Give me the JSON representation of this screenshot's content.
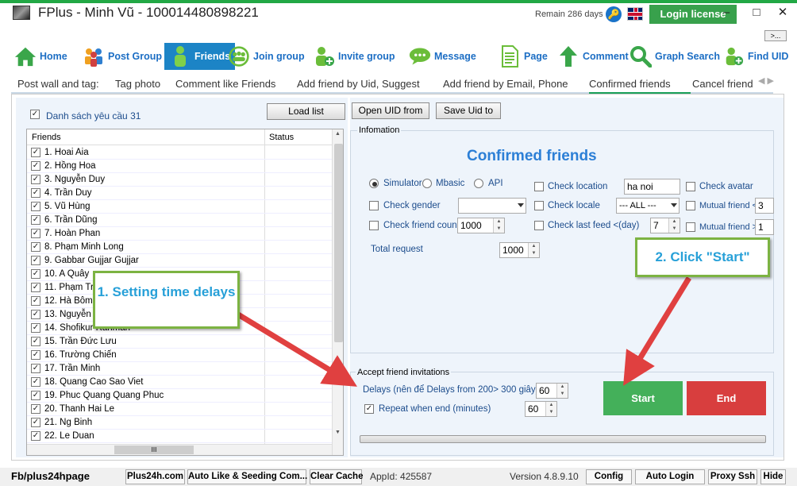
{
  "window": {
    "title": "FPlus - Minh Vũ - 100014480898221",
    "remain": "Remain 286 days",
    "login_license": "Login license",
    "minimize": "–",
    "maximize": "□",
    "close": "✕",
    "more": ">..."
  },
  "nav": [
    {
      "label": "Home",
      "icon": "home-icon"
    },
    {
      "label": "Post Group",
      "icon": "group-icon"
    },
    {
      "label": "Friends",
      "icon": "person-icon",
      "active": true
    },
    {
      "label": "Join group",
      "icon": "people-circle-icon"
    },
    {
      "label": "Invite group",
      "icon": "person-add-icon"
    },
    {
      "label": "Message",
      "icon": "chat-icon"
    },
    {
      "label": "Page",
      "icon": "document-icon"
    },
    {
      "label": "Comment",
      "icon": "arrow-up-icon"
    },
    {
      "label": "Graph Search",
      "icon": "magnifier-icon"
    },
    {
      "label": "Find UID",
      "icon": "person-add-icon"
    }
  ],
  "tabs": [
    "Post wall and tag:",
    "Tag photo",
    "Comment like Friends",
    "Add friend by Uid, Suggest",
    "Add friend by Email, Phone",
    "Confirmed friends",
    "Cancel friend"
  ],
  "active_tab": "Confirmed friends",
  "left": {
    "select_all": "Danh sách yêu cầu 31",
    "load_list": "Load list",
    "open_uid": "Open UID from",
    "save_uid": "Save Uid to",
    "col_friends": "Friends",
    "col_status": "Status",
    "scroll_down": "▼",
    "scroll_up": "▲",
    "hscroll_grip": "III",
    "friends": [
      "1. Hoai Aia",
      "2. Hồng Hoa",
      "3. Nguyễn Duy",
      "4. Trần Duy",
      "5. Vũ Hùng",
      "6. Trần Dũng",
      "7. Hoàn Phan",
      "8. Phạm Minh Long",
      "9. Gabbar Gujjar Gujjar",
      "10. A Quây",
      "11. Phạm Tr",
      "12. Hà Bôm",
      "13. Nguyễn",
      "14. Shofikur Rahman",
      "15. Trần Đức Lưu",
      "16. Trường Chiến",
      "17. Trần Minh",
      "18. Quang Cao Sao Viet",
      "19. Phuc Quang Quang Phuc",
      "20. Thanh Hai Le",
      "21. Ng Binh",
      "22. Le Duan"
    ]
  },
  "info": {
    "group_label": "Infomation",
    "title": "Confirmed friends",
    "simulator": "Simulator",
    "mbasic": "Mbasic",
    "api": "API",
    "check_location": "Check location",
    "location_value": "ha noi",
    "check_avatar": "Check avatar",
    "check_gender": "Check gender",
    "check_locale": "Check locale",
    "locale_value": "--- ALL ---",
    "mutual_lt": "Mutual friend <",
    "mutual_lt_value": "3",
    "check_friend_count": "Check friend count",
    "friend_count_value": "1000",
    "check_last_feed": "Check last feed <(day)",
    "last_feed_value": "7",
    "mutual_gt": "Mutual friend >",
    "mutual_gt_value": "1",
    "total_request": "Total request",
    "total_request_value": "1000"
  },
  "accept": {
    "group_label": "Accept friend invitations",
    "delays_label": "Delays (nên để Delays from 200> 300 giây)",
    "delays_value": "60",
    "repeat_label": "Repeat when end (minutes)",
    "repeat_value": "60",
    "start": "Start",
    "end": "End"
  },
  "callouts": {
    "one": "1. Setting time delays",
    "two": "2. Click \"Start\""
  },
  "statusbar": {
    "fb": "Fb/plus24hpage",
    "plus24h": "Plus24h.com",
    "auto_like": "Auto Like & Seeding Com...",
    "clear_cache": "Clear Cache",
    "appid": "AppId: 425587",
    "version": "Version 4.8.9.10",
    "config": "Config",
    "auto_login": "Auto Login",
    "proxy": "Proxy Ssh",
    "hide": "Hide"
  },
  "colors": {
    "accent": "#1c84c6",
    "start": "#44b05a",
    "end": "#d83e3e",
    "callout_border": "#7cb342",
    "callout_text": "#27a0d8",
    "arrow": "#e04040"
  }
}
